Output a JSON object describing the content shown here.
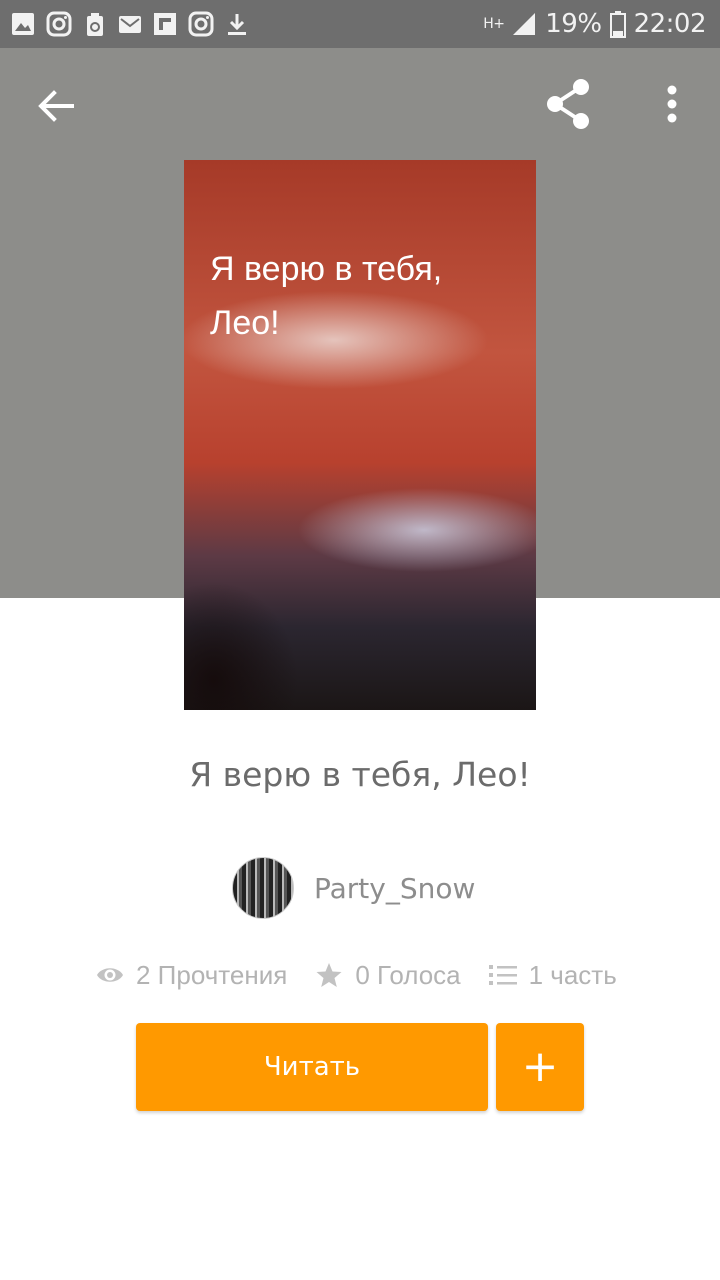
{
  "status_bar": {
    "left_icons": [
      "gallery-icon",
      "instagram-icon",
      "recycle-icon",
      "mail-icon",
      "flipboard-icon",
      "instagram-icon",
      "download-icon"
    ],
    "network": "H+",
    "battery": "19%",
    "time": "22:02"
  },
  "toolbar": {
    "back_icon": "arrow-left-icon",
    "share_icon": "share-icon",
    "more_icon": "more-vertical-icon"
  },
  "cover": {
    "text": "Я верю в тебя, Лео!"
  },
  "story": {
    "title": "Я верю в тебя, Лео!",
    "author": "Party_Snow",
    "reads": "2 Прочтения",
    "votes": "0 Голоса",
    "parts": "1 часть"
  },
  "actions": {
    "read_label": "Читать",
    "add_label": "+"
  },
  "colors": {
    "accent": "#ff9900",
    "header_bg": "#8d8d8a",
    "status_bar_bg": "#6e6e6e"
  }
}
